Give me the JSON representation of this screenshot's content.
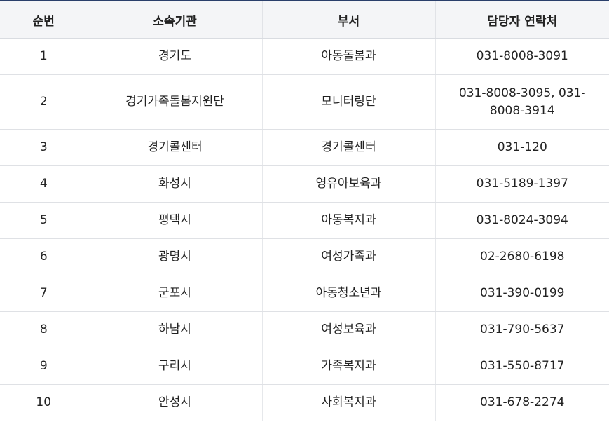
{
  "table": {
    "headers": [
      "순번",
      "소속기관",
      "부서",
      "담당자 연락처"
    ],
    "rows": [
      {
        "no": "1",
        "org": "경기도",
        "dept": "아동돌봄과",
        "contact": "031-8008-3091"
      },
      {
        "no": "2",
        "org": "경기가족돌봄지원단",
        "dept": "모니터링단",
        "contact": "031-8008-3095, 031-8008-3914"
      },
      {
        "no": "3",
        "org": "경기콜센터",
        "dept": "경기콜센터",
        "contact": "031-120"
      },
      {
        "no": "4",
        "org": "화성시",
        "dept": "영유아보육과",
        "contact": "031-5189-1397"
      },
      {
        "no": "5",
        "org": "평택시",
        "dept": "아동복지과",
        "contact": "031-8024-3094"
      },
      {
        "no": "6",
        "org": "광명시",
        "dept": "여성가족과",
        "contact": "02-2680-6198"
      },
      {
        "no": "7",
        "org": "군포시",
        "dept": "아동청소년과",
        "contact": "031-390-0199"
      },
      {
        "no": "8",
        "org": "하남시",
        "dept": "여성보육과",
        "contact": "031-790-5637"
      },
      {
        "no": "9",
        "org": "구리시",
        "dept": "가족복지과",
        "contact": "031-550-8717"
      },
      {
        "no": "10",
        "org": "안성시",
        "dept": "사회복지과",
        "contact": "031-678-2274"
      }
    ]
  }
}
